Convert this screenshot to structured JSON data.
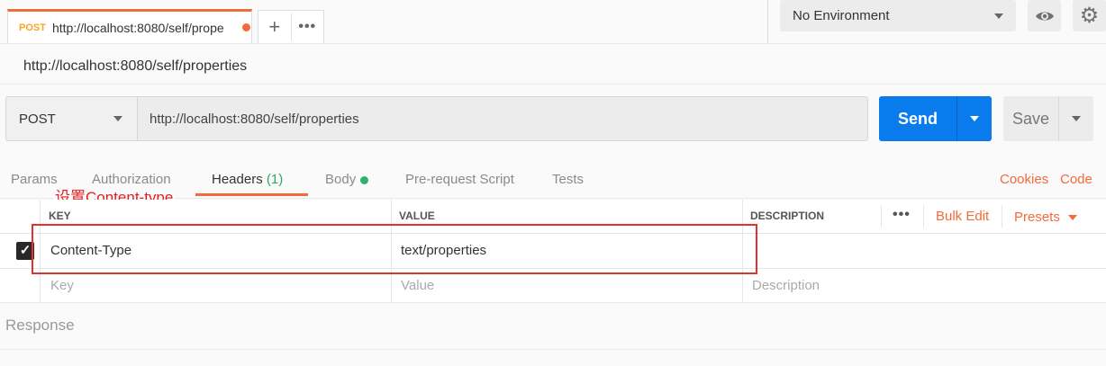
{
  "tab": {
    "method": "POST",
    "url": "http://localhost:8080/self/prope",
    "new_tab_symbol": "+",
    "more_symbol": "•••"
  },
  "environment": {
    "selected": "No Environment"
  },
  "request": {
    "name": "http://localhost:8080/self/properties",
    "method": "POST",
    "url": "http://localhost:8080/self/properties",
    "send_label": "Send",
    "save_label": "Save"
  },
  "request_tabs": [
    {
      "label": "Params"
    },
    {
      "label": "Authorization"
    },
    {
      "label": "Headers",
      "count": "(1)"
    },
    {
      "label": "Body"
    },
    {
      "label": "Pre-request Script"
    },
    {
      "label": "Tests"
    }
  ],
  "links": {
    "cookies": "Cookies",
    "code": "Code"
  },
  "annotation": "设置Content-type",
  "headers_table": {
    "columns": [
      "KEY",
      "VALUE",
      "DESCRIPTION"
    ],
    "more": "•••",
    "bulk_edit": "Bulk Edit",
    "presets": "Presets",
    "rows": [
      {
        "key": "Content-Type",
        "value": "text/properties",
        "description": "",
        "checked": true
      }
    ],
    "placeholders": {
      "key": "Key",
      "value": "Value",
      "description": "Description"
    }
  },
  "response": {
    "label": "Response"
  },
  "colors": {
    "accent": "#f26b3a",
    "send_blue": "#097bed",
    "annotation_red": "#e53030"
  }
}
